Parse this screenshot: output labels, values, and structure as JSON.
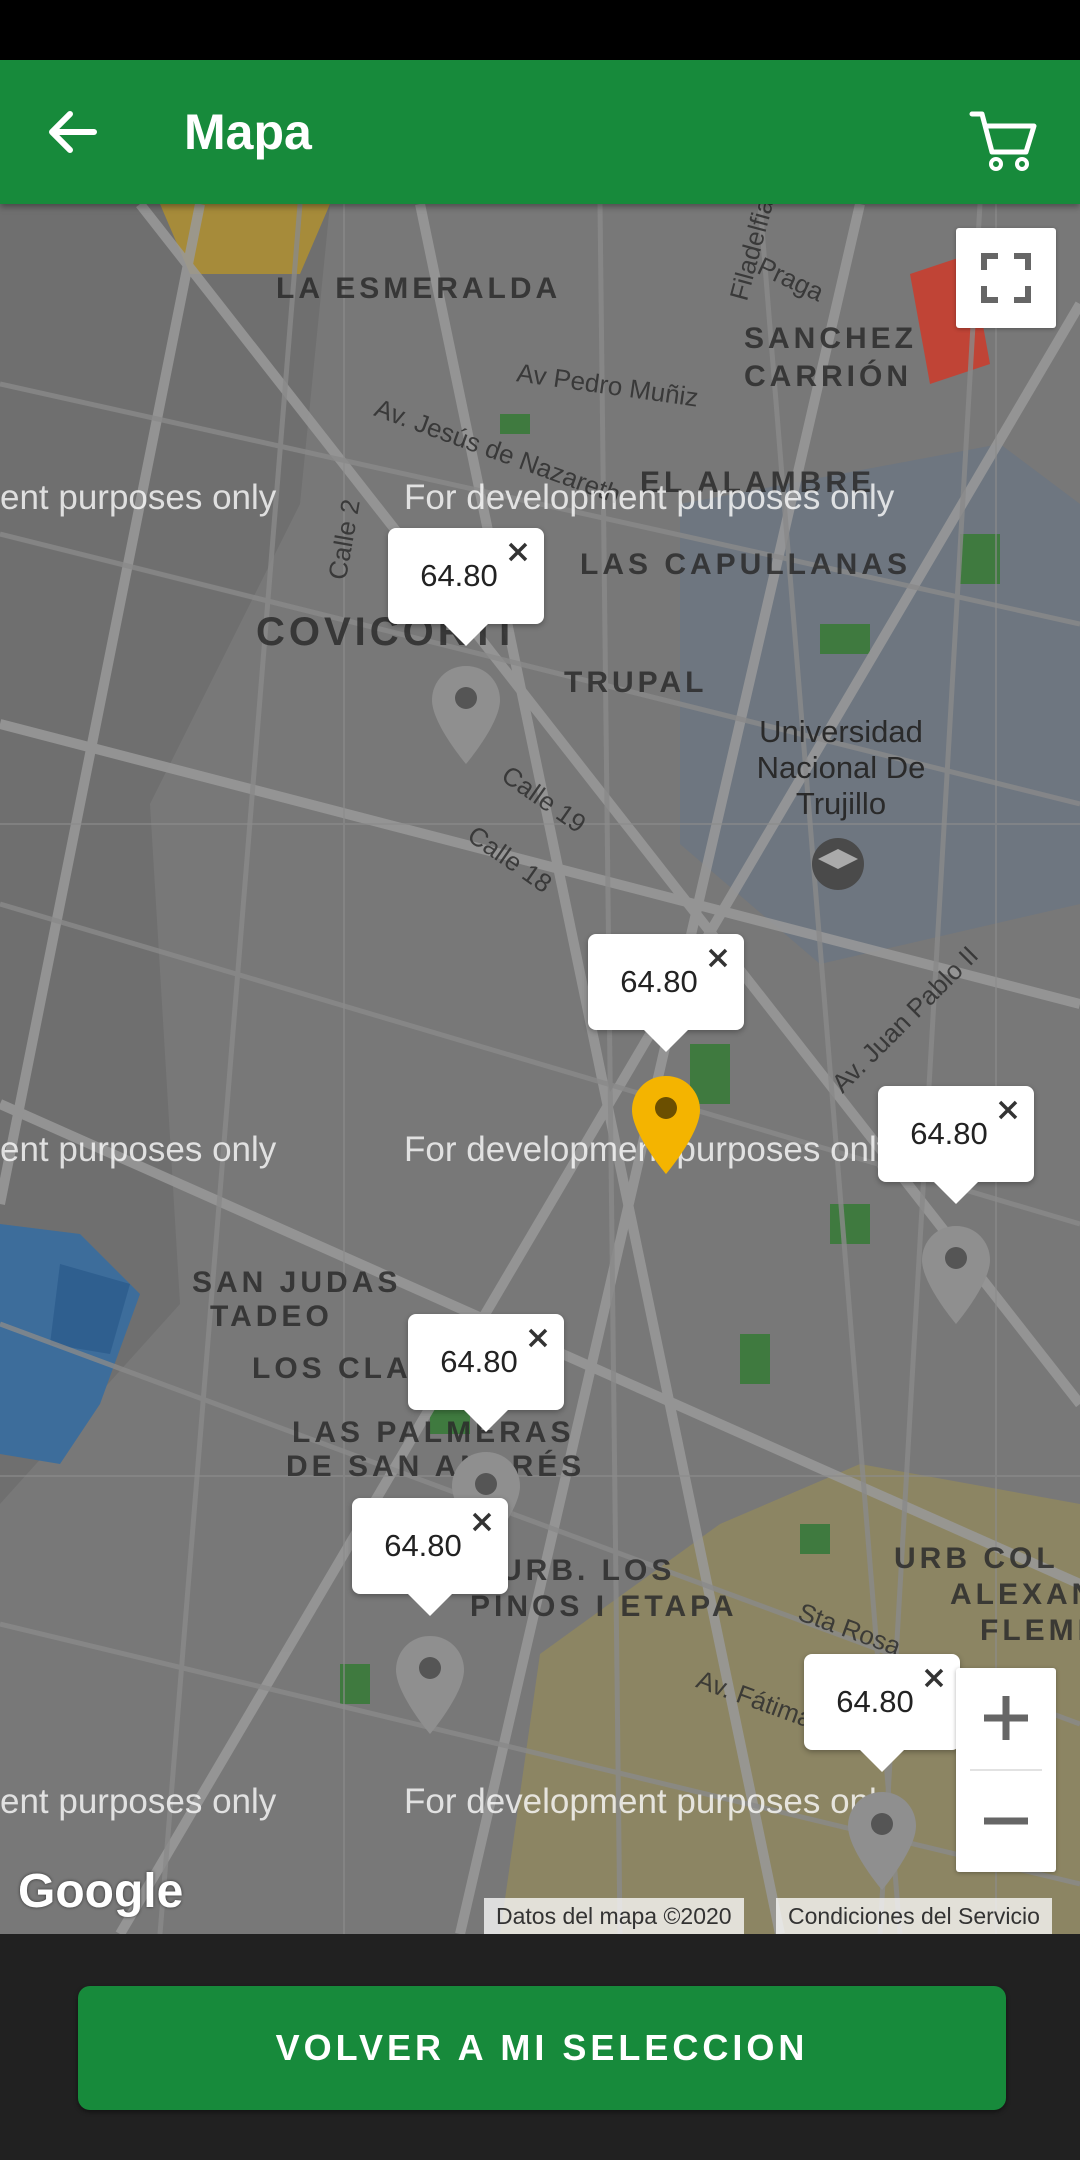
{
  "app_bar": {
    "title": "Mapa",
    "accent_color": "#178a3b",
    "back_icon": "arrow-back-icon",
    "cart_icon": "shopping-cart-icon"
  },
  "map": {
    "neighborhood_labels": [
      "LA ESMERALDA",
      "SANCHEZ",
      "CARRIÓN",
      "EL ALAMBRE",
      "LAS CAPULLANAS",
      "COVICORTI",
      "TRUPAL",
      "SAN JUDAS",
      "TADEO",
      "LOS CLA",
      "LAS PALMERAS",
      "DE SAN ANDRÉS",
      "URB. LOS",
      "PINOS I ETAPA",
      "URB COL",
      "ALEXAN",
      "FLEMIN"
    ],
    "street_labels": [
      "Av Pedro Muñiz",
      "Av. Jesús de Nazareth",
      "Calle 19",
      "Calle 18",
      "Av. Juan Pablo II",
      "Sta Rosa",
      "Av. Fátima",
      "Calle 2",
      "Filadelfia",
      "Praga"
    ],
    "university_label": "Universidad Nacional De Trujillo",
    "watermark": "For development purposes only",
    "watermark_left": "ent purposes only",
    "markers": [
      {
        "price": "64.80",
        "selected": false
      },
      {
        "price": "64.80",
        "selected": true
      },
      {
        "price": "64.80",
        "selected": false
      },
      {
        "price": "64.80",
        "selected": false
      },
      {
        "price": "64.80",
        "selected": false
      },
      {
        "price": "64.80",
        "selected": false
      }
    ],
    "pin_color": "#8f8f8f",
    "selected_pin_color": "#f4b400",
    "fullscreen_icon": "fullscreen-icon",
    "zoom_in_icon": "plus-icon",
    "zoom_out_icon": "minus-icon",
    "logo": "Google",
    "attribution_data": "Datos del mapa ©2020",
    "attribution_terms": "Condiciones del Servicio"
  },
  "bottom": {
    "button_label": "VOLVER A MI SELECCION"
  }
}
